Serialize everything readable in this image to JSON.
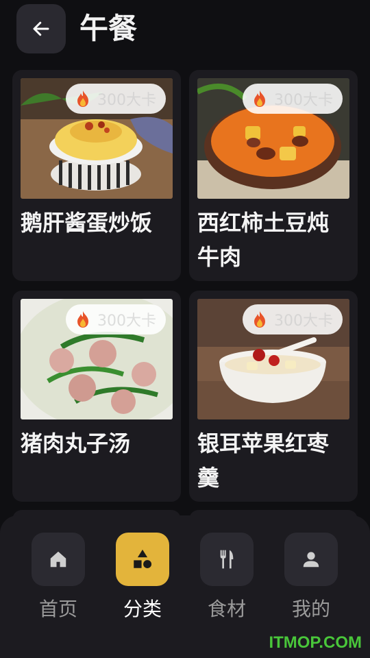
{
  "header": {
    "title": "午餐"
  },
  "recipes": [
    {
      "name": "鹅肝酱蛋炒饭",
      "calories": "300大卡"
    },
    {
      "name": "西红柿土豆炖牛肉",
      "calories": "300大卡"
    },
    {
      "name": "猪肉丸子汤",
      "calories": "300大卡"
    },
    {
      "name": "银耳苹果红枣羹",
      "calories": "300大卡"
    }
  ],
  "nav": [
    {
      "label": "首页",
      "icon": "home-icon",
      "active": false
    },
    {
      "label": "分类",
      "icon": "category-shapes-icon",
      "active": true
    },
    {
      "label": "食材",
      "icon": "fork-knife-icon",
      "active": false
    },
    {
      "label": "我的",
      "icon": "user-icon",
      "active": false
    }
  ],
  "watermark": "ITMOP.COM",
  "colors": {
    "accent": "#e3b43b",
    "background": "#0f0f12",
    "card": "#1c1b20",
    "watermark": "#49c63a"
  }
}
